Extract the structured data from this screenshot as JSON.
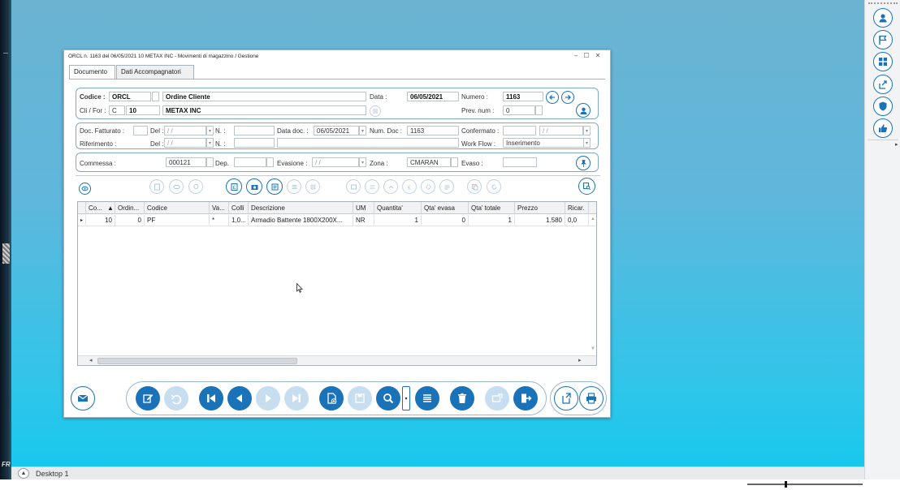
{
  "window": {
    "title": "ORCL n. 1163 del 06/05/2021 10 METAX INC - Movimenti di magazzino / Gestione",
    "controls": [
      "minimize",
      "maximize",
      "close"
    ]
  },
  "tabs": [
    {
      "label": "Documento",
      "active": true
    },
    {
      "label": "Dati Accompagnatori",
      "active": false
    }
  ],
  "header": {
    "codice_label": "Codice :",
    "codice_value": "ORCL",
    "codice_desc": "Ordine Cliente",
    "data_label": "Data :",
    "data_value": "06/05/2021",
    "numero_label": "Numero :",
    "numero_value": "1163",
    "clifor_label": "Cli / For :",
    "clifor_type": "C",
    "clifor_code": "10",
    "clifor_name": "METAX INC",
    "prevnum_label": "Prev. num :",
    "prevnum_value": "0"
  },
  "refs": {
    "docfatt_label": "Doc. Fatturato :",
    "del_label": "Del :",
    "del_value": " / /",
    "n_label": "N. :",
    "datadoc_label": "Data doc. :",
    "datadoc_value": "06/05/2021",
    "numdoc_label": "Num. Doc :",
    "numdoc_value": "1163",
    "confermato_label": "Confermato :",
    "confermato_date": " / /",
    "riferimento_label": "Riferimento :",
    "del2_label": "Del :",
    "del2_value": " / /",
    "n2_label": "N. :",
    "workflow_label": "Work Flow :",
    "workflow_value": "Inserimento"
  },
  "commessa": {
    "commessa_label": "Commessa :",
    "commessa_value": "000121",
    "dep_label": "Dep.",
    "evasione_label": "Evasione :",
    "evasione_value": " / /",
    "zona_label": "Zona :",
    "zona_value": "CMARAN",
    "evaso_label": "Evaso :"
  },
  "grid": {
    "columns": [
      "Co...",
      "Ordin...",
      "Codice",
      "Va...",
      "Colli",
      "Descrizione",
      "UM",
      "Quantita'",
      "Qta' evasa",
      "Qta' totale",
      "Prezzo",
      "Ricar."
    ],
    "rows": [
      [
        "10",
        "0",
        "PF",
        "*",
        "1,0...",
        "Armadio Battente 1800X200X...",
        "NR",
        "1",
        "0",
        "1",
        "1.580",
        "0,0"
      ]
    ]
  },
  "taskbar": {
    "desktop_label": "Desktop 1"
  },
  "desktop": {
    "left_mark": "FR"
  },
  "colors": {
    "accent": "#1a73b8",
    "disabled": "#c7ddf0",
    "group_border": "#7fa9d3"
  }
}
